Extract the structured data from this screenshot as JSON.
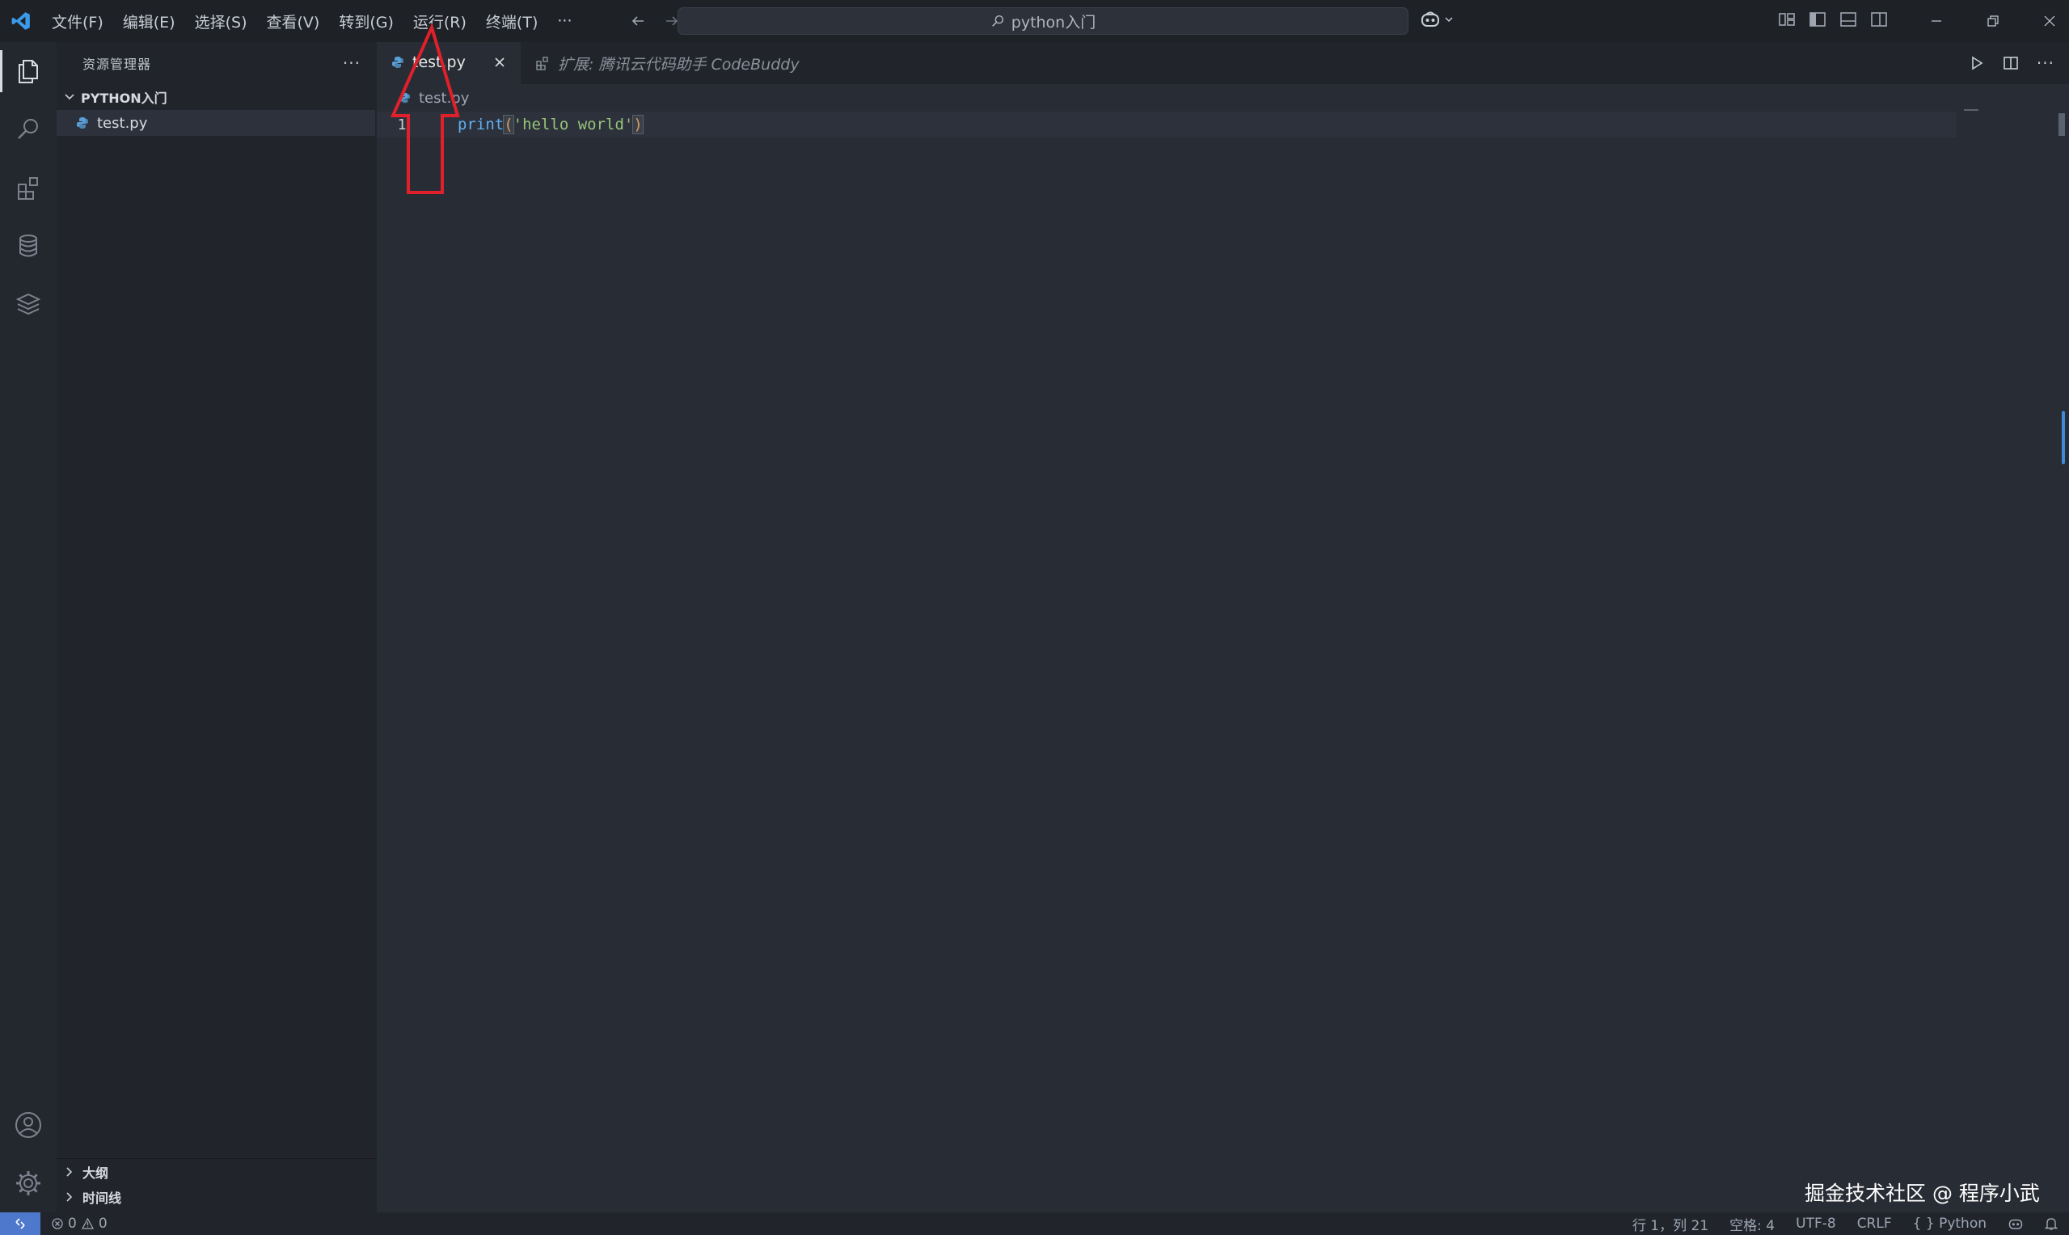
{
  "titlebar": {
    "menu": [
      "文件(F)",
      "编辑(E)",
      "选择(S)",
      "查看(V)",
      "转到(G)",
      "运行(R)",
      "终端(T)",
      "···"
    ],
    "search_text": "python入门"
  },
  "sidebar": {
    "title": "资源管理器",
    "more": "···",
    "folder": "PYTHON入门",
    "files": [
      {
        "name": "test.py"
      }
    ],
    "sections": {
      "outline": "大纲",
      "timeline": "时间线"
    }
  },
  "editor": {
    "tabs": [
      {
        "label": "test.py",
        "active": true
      },
      {
        "label": "扩展: 腾讯云代码助手 CodeBuddy",
        "active": false
      }
    ],
    "breadcrumb": "test.py",
    "lines": [
      {
        "number": "1",
        "fn": "print",
        "open": "(",
        "str": "'hello world'",
        "close": ")"
      }
    ]
  },
  "statusbar": {
    "errors": "0",
    "warnings": "0",
    "position": "行 1，列 21",
    "spaces": "空格: 4",
    "encoding": "UTF-8",
    "eol": "CRLF",
    "language": "{ } Python"
  },
  "watermark": "掘金技术社区 @ 程序小武",
  "colors": {
    "accent": "#4d78cc",
    "annotation": "#e0202a",
    "editor_bg": "#282c34",
    "sidebar_bg": "#21252b"
  },
  "icons": [
    "vscode-logo-icon",
    "files-icon",
    "search-icon",
    "extensions-icon",
    "database-icon",
    "layers-icon",
    "account-icon",
    "settings-gear-icon",
    "python-file-icon",
    "close-icon",
    "run-icon",
    "split-editor-icon",
    "copilot-icon",
    "bell-icon"
  ]
}
